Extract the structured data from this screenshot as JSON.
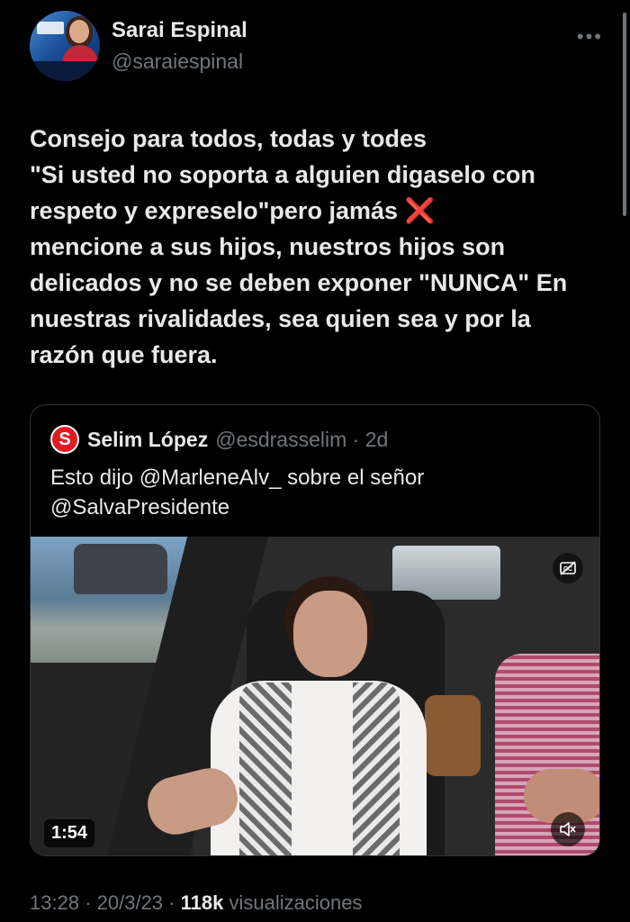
{
  "author": {
    "name": "Sarai Espinal",
    "handle": "@saraiespinal"
  },
  "tweet": {
    "text_before_icon": "Consejo para todos, todas y todes\n\"Si usted no soporta a alguien digaselo con respeto y expreselo\"pero jamás ",
    "icon": "cross-mark-icon",
    "icon_glyph": "❌",
    "text_after_icon": "\nmencione a sus hijos, nuestros hijos son delicados y no se deben exponer \"NUNCA\" En nuestras rivalidades, sea quien sea y por la razón que fuera."
  },
  "quoted_tweet": {
    "author_name": "Selim López",
    "author_handle": "@esdrasselim",
    "separator": "·",
    "age": "2d",
    "avatar_letter": "S",
    "text": "Esto dijo @MarleneAlv_ sobre el señor\n@SalvaPresidente",
    "video": {
      "duration": "1:54",
      "captions_icon": "captions-icon",
      "mute_icon": "muted-speaker-icon"
    }
  },
  "meta": {
    "time": "13:28",
    "separator": "·",
    "date": "20/3/23",
    "views_count": "118k",
    "views_label": "visualizaciones"
  },
  "colors": {
    "background": "#000000",
    "text": "#e7e9ea",
    "secondary": "#71767b",
    "border": "#2f3336",
    "quote_avatar": "#e21b22"
  }
}
